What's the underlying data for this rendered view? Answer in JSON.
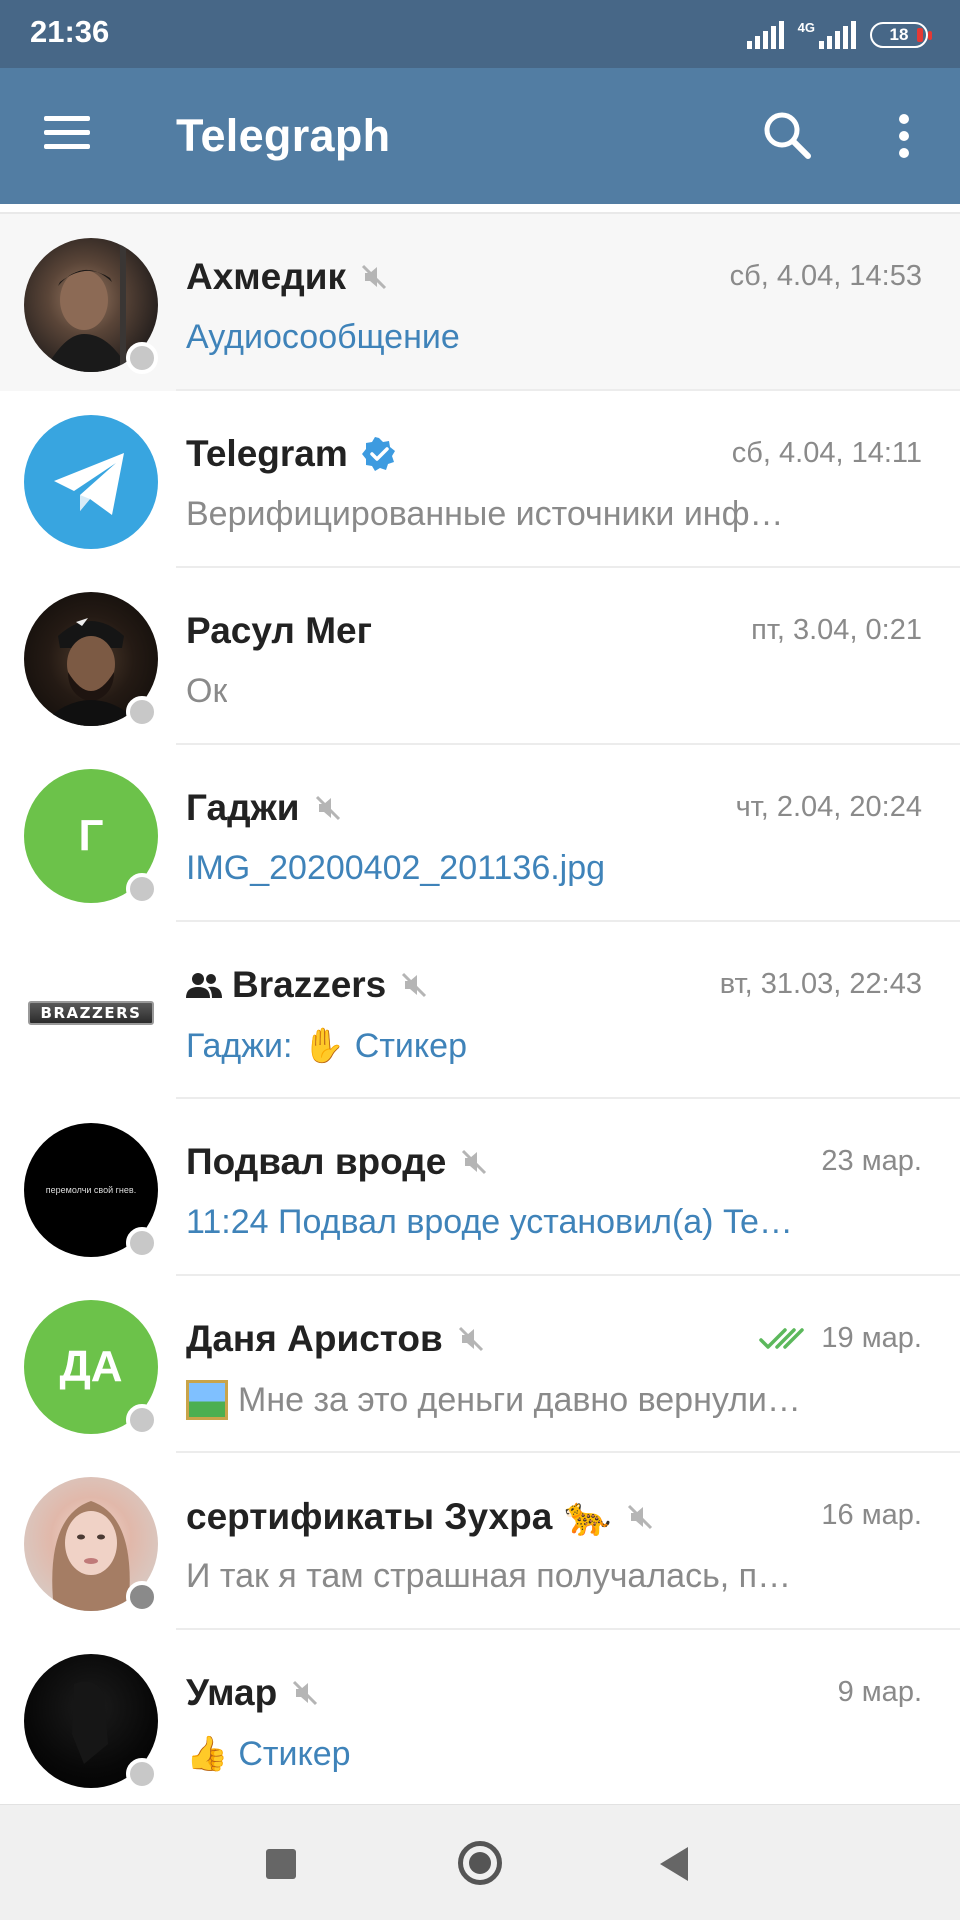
{
  "status_bar": {
    "time": "21:36",
    "network": "4G",
    "battery": "18"
  },
  "app_bar": {
    "title": "Telegraph",
    "menu_icon": "hamburger-menu-icon",
    "search_icon": "search-icon",
    "more_icon": "more-vert-icon"
  },
  "colors": {
    "status_bar": "#476787",
    "app_bar": "#527da3",
    "link_blue": "#3f83b9",
    "avatar_green": "#6cc24a",
    "telegram_blue": "#38a5e0"
  },
  "chats": [
    {
      "name": "Ахмедик",
      "time": "сб, 4.04, 14:53",
      "preview": "Аудиосообщение",
      "muted": true,
      "avatar_initials": ""
    },
    {
      "name": "Telegram",
      "time": "сб, 4.04, 14:11",
      "preview": "Верифицированные источники инф…",
      "verified": true
    },
    {
      "name": "Расул Мег",
      "time": "пт, 3.04, 0:21",
      "preview": "Ок"
    },
    {
      "name": "Гаджи",
      "time": "чт, 2.04, 20:24",
      "preview": "IMG_20200402_201136.jpg",
      "muted": true,
      "avatar_initials": "Г"
    },
    {
      "name": "Brazzers",
      "time": "вт, 31.03, 22:43",
      "preview_sender": "Гаджи:",
      "preview_emoji": "✋",
      "preview": "Стикер",
      "muted": true,
      "is_group": true,
      "avatar_logo_text": "BRAZZERS"
    },
    {
      "name": "Подвал вроде",
      "time": "23 мар.",
      "preview": "11:24 Подвал вроде установил(а) Te…",
      "muted": true,
      "avatar_caption": "перемолчи свой гнев."
    },
    {
      "name": "Даня Аристов",
      "time": "19 мар.",
      "preview": "Мне за это деньги давно вернули…",
      "muted": true,
      "read_receipt": "double-check-icon",
      "avatar_initials": "ДА"
    },
    {
      "name": "сертификаты Зухра",
      "name_emoji": "🐆",
      "time": "16 мар.",
      "preview": "И так я там страшная получалась, п…",
      "muted": true
    },
    {
      "name": "Умар",
      "time": "9 мар.",
      "preview_emoji": "👍",
      "preview": "Стикер",
      "muted": true
    }
  ],
  "nav_bar": {
    "recents_icon": "recents-square-icon",
    "home_icon": "home-circle-icon",
    "back_icon": "back-triangle-icon"
  }
}
